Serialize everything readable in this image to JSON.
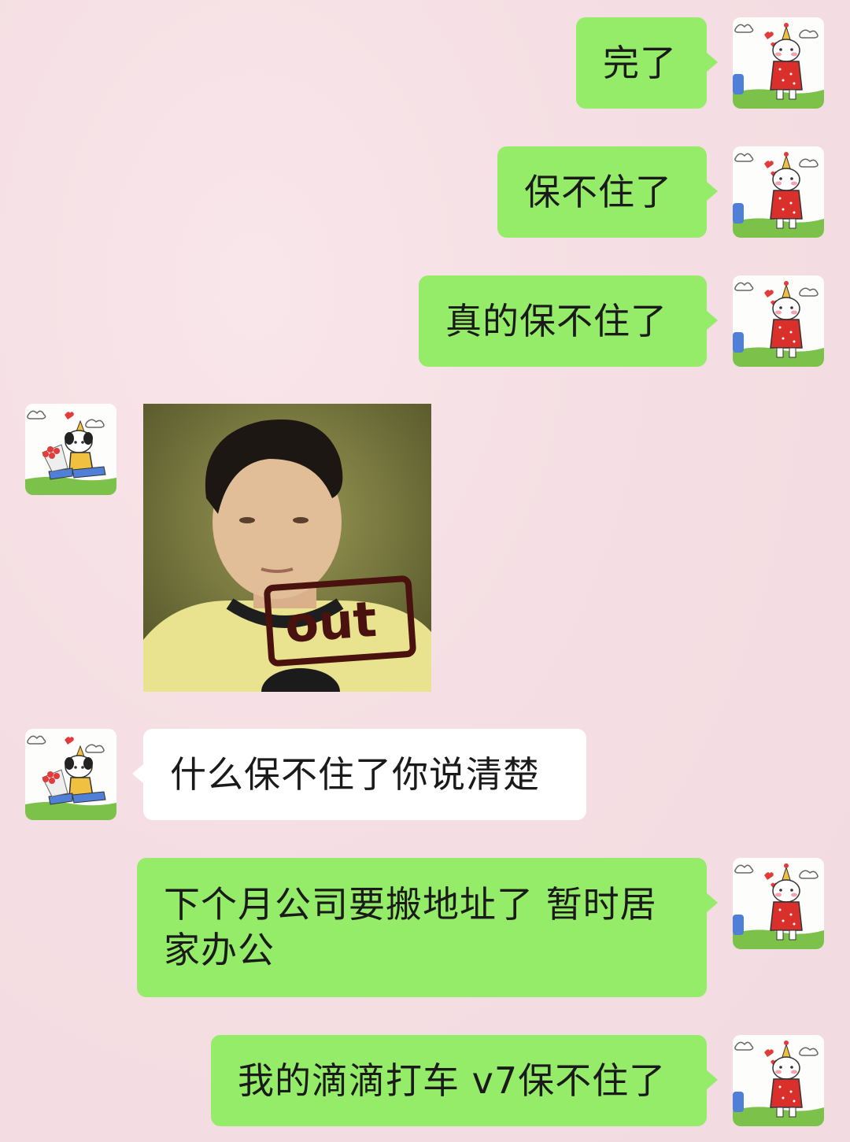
{
  "messages": [
    {
      "side": "right",
      "type": "text",
      "text": "完了"
    },
    {
      "side": "right",
      "type": "text",
      "text": "保不住了"
    },
    {
      "side": "right",
      "type": "text",
      "text": "真的保不住了"
    },
    {
      "side": "left",
      "type": "image",
      "image_text": "out"
    },
    {
      "side": "left",
      "type": "text",
      "text": "什么保不住了你说清楚"
    },
    {
      "side": "right",
      "type": "text",
      "text": "下个月公司要搬地址了 暂时居家办公"
    },
    {
      "side": "right",
      "type": "text",
      "text": "我的滴滴打车 v7保不住了"
    }
  ],
  "colors": {
    "right_bubble": "#95ec69",
    "left_bubble": "#ffffff",
    "background": "#f4dee3"
  },
  "icons": {
    "right_avatar": "cat-in-red-dress-avatar-icon",
    "left_avatar": "dog-with-flowers-avatar-icon"
  }
}
